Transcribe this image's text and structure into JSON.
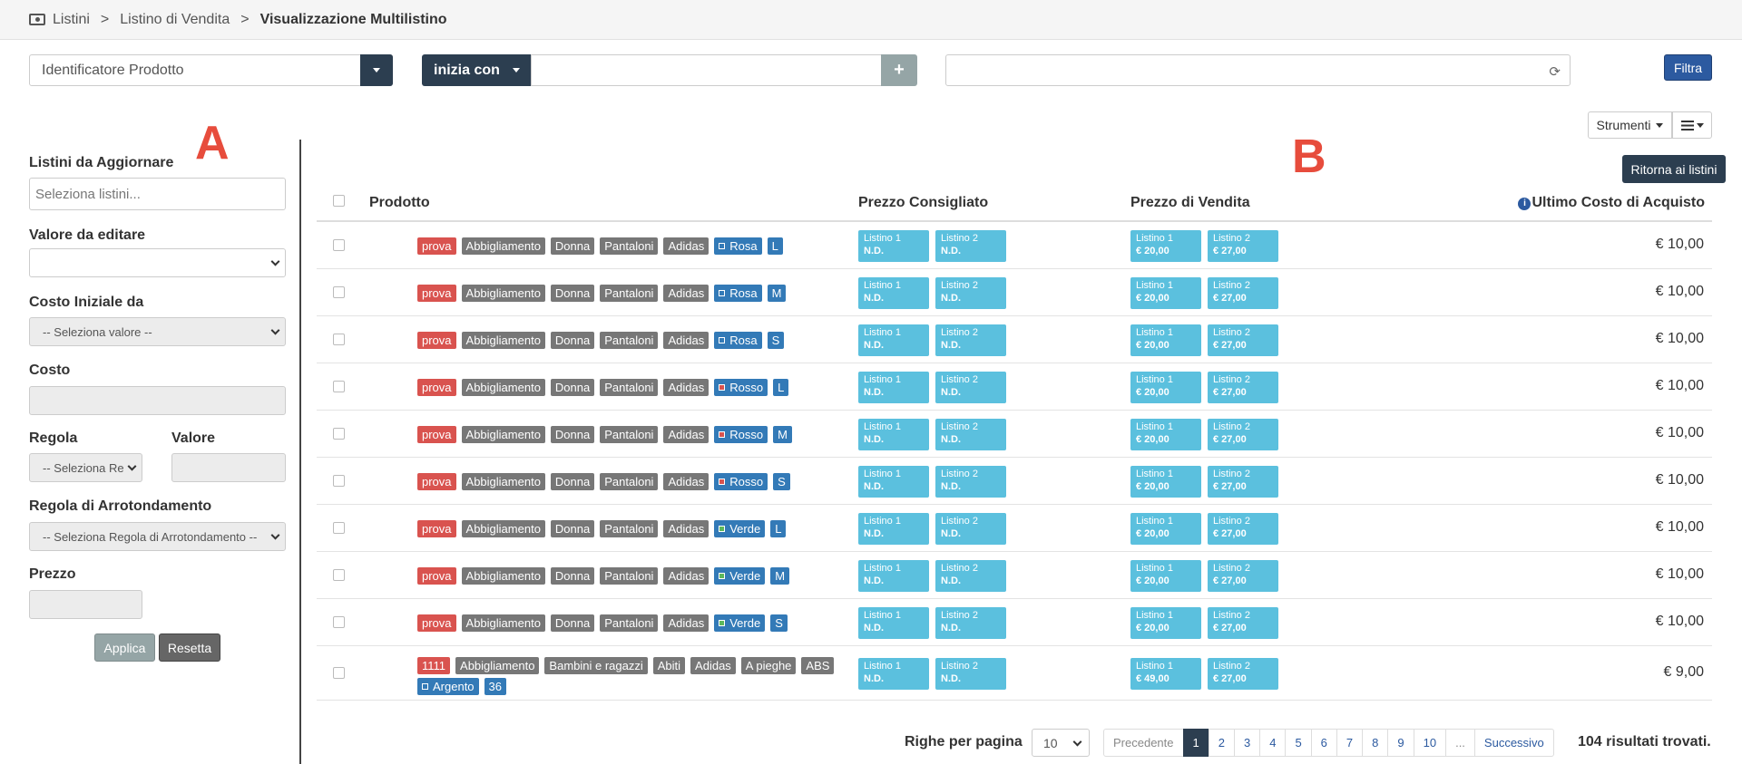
{
  "breadcrumb": {
    "items": [
      "Listini",
      "Listino di Vendita"
    ],
    "current": "Visualizzazione Multilistino",
    "separator": ">"
  },
  "filter": {
    "field_select": "Identificatore Prodotto",
    "condition": "inizia con",
    "value": "",
    "add_label": "+",
    "search_value": "",
    "submit_label": "Filtra"
  },
  "tools": {
    "strumenti_label": "Strumenti",
    "ritorna_label": "Ritorna ai listini"
  },
  "annotations": {
    "a": "A",
    "b": "B"
  },
  "left_panel": {
    "listini_label": "Listini da Aggiornare",
    "listini_placeholder": "Seleziona listini...",
    "valore_label": "Valore da editare",
    "valore_value": "",
    "costo_iniziale_label": "Costo Iniziale da",
    "costo_iniziale_value": "-- Seleziona valore --",
    "costo_label": "Costo",
    "regola_label": "Regola",
    "regola_value": "-- Seleziona Re",
    "valore2_label": "Valore",
    "arrotondamento_label": "Regola di Arrotondamento",
    "arrotondamento_value": "-- Seleziona Regola di Arrotondamento --",
    "prezzo_label": "Prezzo",
    "applica_label": "Applica",
    "resetta_label": "Resetta"
  },
  "table": {
    "headers": {
      "prodotto": "Prodotto",
      "consigliato": "Prezzo Consigliato",
      "vendita": "Prezzo di Vendita",
      "ultimo_costo": "Ultimo Costo di Acquisto",
      "info_icon": "i"
    },
    "rows": [
      {
        "tags": [
          {
            "text": "prova",
            "color": "red"
          },
          {
            "text": "Abbigliamento",
            "color": "gray"
          },
          {
            "text": "Donna",
            "color": "gray"
          },
          {
            "text": "Pantaloni",
            "color": "gray"
          },
          {
            "text": "Adidas",
            "color": "gray"
          },
          {
            "text": "Rosa",
            "color": "blue",
            "swatch": "#337ab7"
          },
          {
            "text": "L",
            "color": "blue"
          }
        ],
        "consigliato": [
          {
            "name": "Listino 1",
            "value": "N.D."
          },
          {
            "name": "Listino 2",
            "value": "N.D."
          }
        ],
        "vendita": [
          {
            "name": "Listino 1",
            "value": "€ 20,00"
          },
          {
            "name": "Listino 2",
            "value": "€ 27,00"
          }
        ],
        "cost": "€ 10,00"
      },
      {
        "tags": [
          {
            "text": "prova",
            "color": "red"
          },
          {
            "text": "Abbigliamento",
            "color": "gray"
          },
          {
            "text": "Donna",
            "color": "gray"
          },
          {
            "text": "Pantaloni",
            "color": "gray"
          },
          {
            "text": "Adidas",
            "color": "gray"
          },
          {
            "text": "Rosa",
            "color": "blue",
            "swatch": "#337ab7"
          },
          {
            "text": "M",
            "color": "blue"
          }
        ],
        "consigliato": [
          {
            "name": "Listino 1",
            "value": "N.D."
          },
          {
            "name": "Listino 2",
            "value": "N.D."
          }
        ],
        "vendita": [
          {
            "name": "Listino 1",
            "value": "€ 20,00"
          },
          {
            "name": "Listino 2",
            "value": "€ 27,00"
          }
        ],
        "cost": "€ 10,00"
      },
      {
        "tags": [
          {
            "text": "prova",
            "color": "red"
          },
          {
            "text": "Abbigliamento",
            "color": "gray"
          },
          {
            "text": "Donna",
            "color": "gray"
          },
          {
            "text": "Pantaloni",
            "color": "gray"
          },
          {
            "text": "Adidas",
            "color": "gray"
          },
          {
            "text": "Rosa",
            "color": "blue",
            "swatch": "#337ab7"
          },
          {
            "text": "S",
            "color": "blue"
          }
        ],
        "consigliato": [
          {
            "name": "Listino 1",
            "value": "N.D."
          },
          {
            "name": "Listino 2",
            "value": "N.D."
          }
        ],
        "vendita": [
          {
            "name": "Listino 1",
            "value": "€ 20,00"
          },
          {
            "name": "Listino 2",
            "value": "€ 27,00"
          }
        ],
        "cost": "€ 10,00"
      },
      {
        "tags": [
          {
            "text": "prova",
            "color": "red"
          },
          {
            "text": "Abbigliamento",
            "color": "gray"
          },
          {
            "text": "Donna",
            "color": "gray"
          },
          {
            "text": "Pantaloni",
            "color": "gray"
          },
          {
            "text": "Adidas",
            "color": "gray"
          },
          {
            "text": "Rosso",
            "color": "blue",
            "swatch": "#d9534f"
          },
          {
            "text": "L",
            "color": "blue"
          }
        ],
        "consigliato": [
          {
            "name": "Listino 1",
            "value": "N.D."
          },
          {
            "name": "Listino 2",
            "value": "N.D."
          }
        ],
        "vendita": [
          {
            "name": "Listino 1",
            "value": "€ 20,00"
          },
          {
            "name": "Listino 2",
            "value": "€ 27,00"
          }
        ],
        "cost": "€ 10,00"
      },
      {
        "tags": [
          {
            "text": "prova",
            "color": "red"
          },
          {
            "text": "Abbigliamento",
            "color": "gray"
          },
          {
            "text": "Donna",
            "color": "gray"
          },
          {
            "text": "Pantaloni",
            "color": "gray"
          },
          {
            "text": "Adidas",
            "color": "gray"
          },
          {
            "text": "Rosso",
            "color": "blue",
            "swatch": "#d9534f"
          },
          {
            "text": "M",
            "color": "blue"
          }
        ],
        "consigliato": [
          {
            "name": "Listino 1",
            "value": "N.D."
          },
          {
            "name": "Listino 2",
            "value": "N.D."
          }
        ],
        "vendita": [
          {
            "name": "Listino 1",
            "value": "€ 20,00"
          },
          {
            "name": "Listino 2",
            "value": "€ 27,00"
          }
        ],
        "cost": "€ 10,00"
      },
      {
        "tags": [
          {
            "text": "prova",
            "color": "red"
          },
          {
            "text": "Abbigliamento",
            "color": "gray"
          },
          {
            "text": "Donna",
            "color": "gray"
          },
          {
            "text": "Pantaloni",
            "color": "gray"
          },
          {
            "text": "Adidas",
            "color": "gray"
          },
          {
            "text": "Rosso",
            "color": "blue",
            "swatch": "#d9534f"
          },
          {
            "text": "S",
            "color": "blue"
          }
        ],
        "consigliato": [
          {
            "name": "Listino 1",
            "value": "N.D."
          },
          {
            "name": "Listino 2",
            "value": "N.D."
          }
        ],
        "vendita": [
          {
            "name": "Listino 1",
            "value": "€ 20,00"
          },
          {
            "name": "Listino 2",
            "value": "€ 27,00"
          }
        ],
        "cost": "€ 10,00"
      },
      {
        "tags": [
          {
            "text": "prova",
            "color": "red"
          },
          {
            "text": "Abbigliamento",
            "color": "gray"
          },
          {
            "text": "Donna",
            "color": "gray"
          },
          {
            "text": "Pantaloni",
            "color": "gray"
          },
          {
            "text": "Adidas",
            "color": "gray"
          },
          {
            "text": "Verde",
            "color": "blue",
            "swatch": "#5cb85c"
          },
          {
            "text": "L",
            "color": "blue"
          }
        ],
        "consigliato": [
          {
            "name": "Listino 1",
            "value": "N.D."
          },
          {
            "name": "Listino 2",
            "value": "N.D."
          }
        ],
        "vendita": [
          {
            "name": "Listino 1",
            "value": "€ 20,00"
          },
          {
            "name": "Listino 2",
            "value": "€ 27,00"
          }
        ],
        "cost": "€ 10,00"
      },
      {
        "tags": [
          {
            "text": "prova",
            "color": "red"
          },
          {
            "text": "Abbigliamento",
            "color": "gray"
          },
          {
            "text": "Donna",
            "color": "gray"
          },
          {
            "text": "Pantaloni",
            "color": "gray"
          },
          {
            "text": "Adidas",
            "color": "gray"
          },
          {
            "text": "Verde",
            "color": "blue",
            "swatch": "#5cb85c"
          },
          {
            "text": "M",
            "color": "blue"
          }
        ],
        "consigliato": [
          {
            "name": "Listino 1",
            "value": "N.D."
          },
          {
            "name": "Listino 2",
            "value": "N.D."
          }
        ],
        "vendita": [
          {
            "name": "Listino 1",
            "value": "€ 20,00"
          },
          {
            "name": "Listino 2",
            "value": "€ 27,00"
          }
        ],
        "cost": "€ 10,00"
      },
      {
        "tags": [
          {
            "text": "prova",
            "color": "red"
          },
          {
            "text": "Abbigliamento",
            "color": "gray"
          },
          {
            "text": "Donna",
            "color": "gray"
          },
          {
            "text": "Pantaloni",
            "color": "gray"
          },
          {
            "text": "Adidas",
            "color": "gray"
          },
          {
            "text": "Verde",
            "color": "blue",
            "swatch": "#5cb85c"
          },
          {
            "text": "S",
            "color": "blue"
          }
        ],
        "consigliato": [
          {
            "name": "Listino 1",
            "value": "N.D."
          },
          {
            "name": "Listino 2",
            "value": "N.D."
          }
        ],
        "vendita": [
          {
            "name": "Listino 1",
            "value": "€ 20,00"
          },
          {
            "name": "Listino 2",
            "value": "€ 27,00"
          }
        ],
        "cost": "€ 10,00"
      },
      {
        "tags": [
          {
            "text": "1111",
            "color": "red"
          },
          {
            "text": "Abbigliamento",
            "color": "gray"
          },
          {
            "text": "Bambini e ragazzi",
            "color": "gray"
          },
          {
            "text": "Abiti",
            "color": "gray"
          },
          {
            "text": "Adidas",
            "color": "gray"
          },
          {
            "text": "A pieghe",
            "color": "gray"
          },
          {
            "text": "ABS",
            "color": "gray"
          },
          {
            "text": "Argento",
            "color": "blue",
            "swatch": "#337ab7"
          },
          {
            "text": "36",
            "color": "blue"
          }
        ],
        "consigliato": [
          {
            "name": "Listino 1",
            "value": "N.D."
          },
          {
            "name": "Listino 2",
            "value": "N.D."
          }
        ],
        "vendita": [
          {
            "name": "Listino 1",
            "value": "€ 49,00"
          },
          {
            "name": "Listino 2",
            "value": "€ 27,00"
          }
        ],
        "cost": "€ 9,00",
        "tall": true
      }
    ]
  },
  "pagination": {
    "rows_label": "Righe per pagina",
    "rows_value": "10",
    "prev_label": "Precedente",
    "pages": [
      "1",
      "2",
      "3",
      "4",
      "5",
      "6",
      "7",
      "8",
      "9",
      "10",
      "..."
    ],
    "active_page": "1",
    "next_label": "Successivo",
    "results_text": "104 risultati trovati."
  }
}
